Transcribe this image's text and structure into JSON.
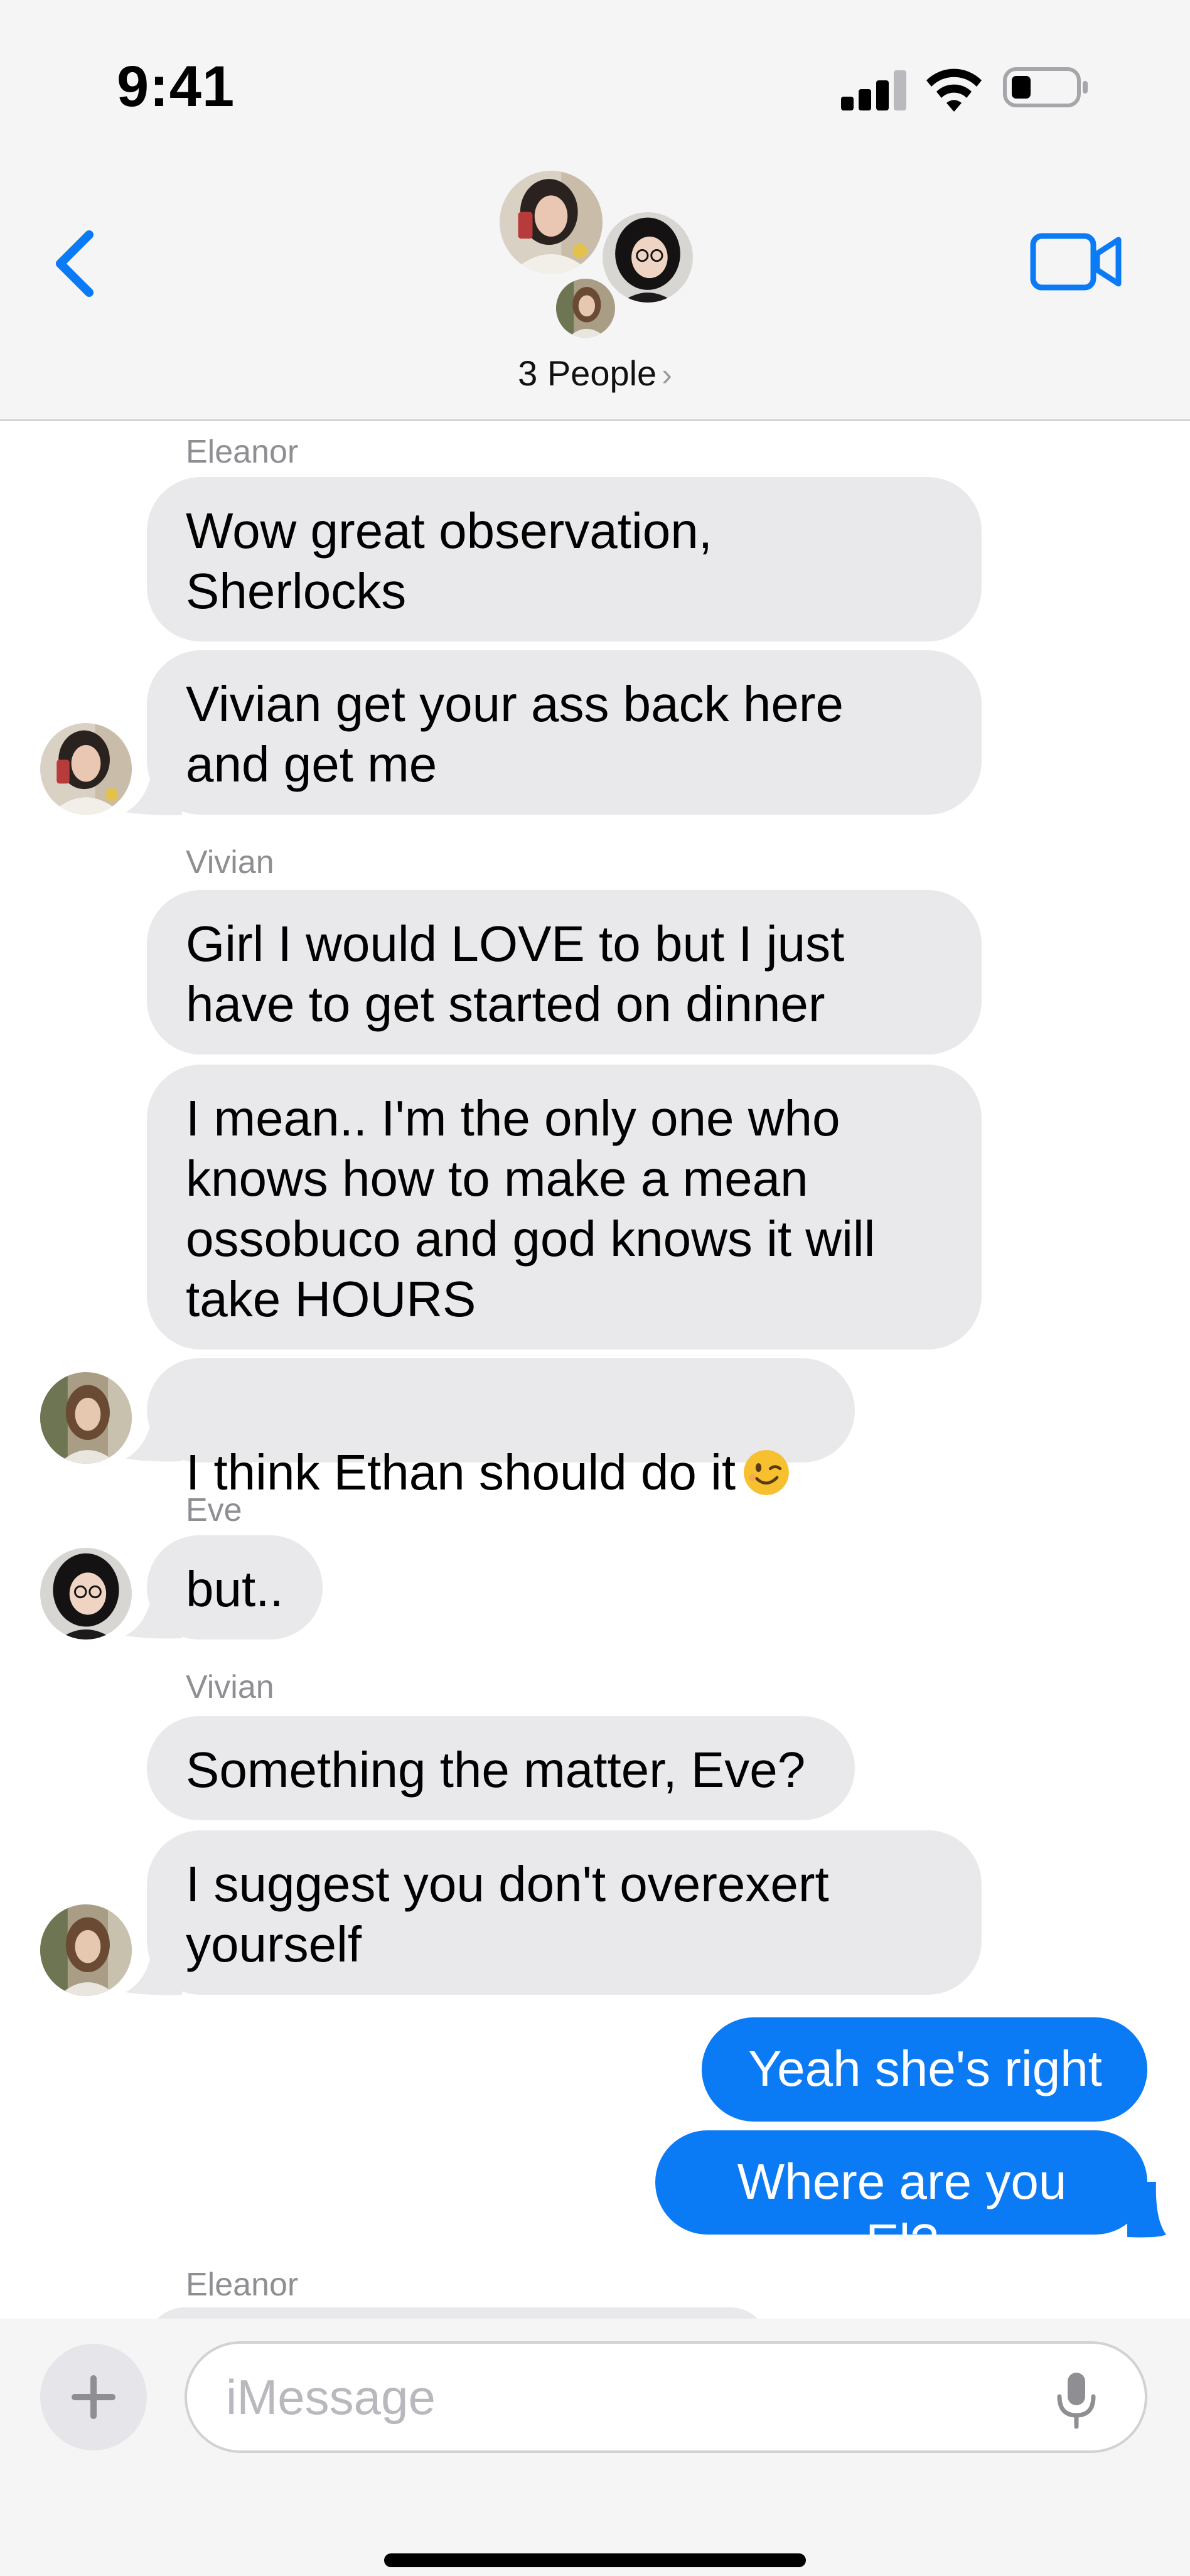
{
  "status_bar": {
    "time": "9:41"
  },
  "header": {
    "group_label": "3 People",
    "chevron": "›",
    "icons": [
      "back-chevron-icon",
      "video-camera-icon"
    ]
  },
  "messages": [
    {
      "sender": "Eleanor"
    },
    {
      "text": "Wow great observation,\nSherlocks"
    },
    {
      "text": "Vivian get your ass back here\nand get me"
    },
    {
      "sender": "Vivian"
    },
    {
      "text": "Girl I would LOVE to but I just\nhave to get started on dinner"
    },
    {
      "text": "I mean.. I'm the only one who\nknows how to make a mean\nossobuco and god knows it will\ntake HOURS"
    },
    {
      "text": "I think Ethan should do it",
      "emoji": "winking-face-icon"
    },
    {
      "sender": "Eve"
    },
    {
      "text": "but.."
    },
    {
      "sender": "Vivian"
    },
    {
      "text": "Something the matter, Eve?"
    },
    {
      "text": "I suggest you don't overexert\nyourself"
    },
    {
      "text": "Yeah she's right"
    },
    {
      "text": "Where are you El?"
    },
    {
      "sender": "Eleanor"
    }
  ],
  "composer": {
    "placeholder": "iMessage",
    "plus": "+"
  },
  "colors": {
    "incoming_bubble": "#e9e9eb",
    "outgoing_bubble": "#0b7af5",
    "accent": "#0b7af5",
    "header_bg": "#f5f5f6"
  }
}
